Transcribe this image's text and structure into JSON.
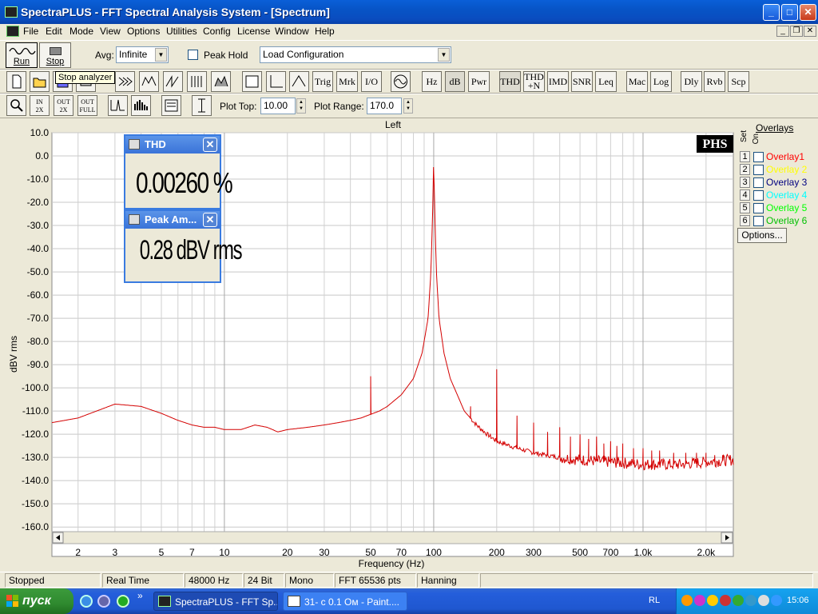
{
  "window": {
    "title": "SpectraPLUS - FFT Spectral Analysis System - [Spectrum]",
    "min_glyph": "_",
    "max_glyph": "□",
    "close_glyph": "✕",
    "mdi_min_glyph": "_",
    "mdi_restore_glyph": "❐",
    "mdi_close_glyph": "✕"
  },
  "menu": [
    "File",
    "Edit",
    "Mode",
    "View",
    "Options",
    "Utilities",
    "Config",
    "License",
    "Window",
    "Help"
  ],
  "toolbar1": {
    "run_label": "Run",
    "stop_label": "Stop",
    "avg_label": "Avg:",
    "avg_value": "Infinite",
    "peak_hold_label": "Peak Hold",
    "config_value": "Load Configuration",
    "tooltip": "Stop analyzer"
  },
  "toolbar2": {
    "buttons": [
      "Trig",
      "Mrk",
      "I/O",
      "Hz",
      "dB",
      "Pwr",
      "THD",
      "IMD",
      "SNR",
      "Leq",
      "Mac",
      "Log",
      "Dly",
      "Rvb",
      "Scp"
    ],
    "thdn_line1": "THD",
    "thdn_line2": "+N"
  },
  "toolbar3": {
    "plot_top_label": "Plot Top:",
    "plot_top_value": "10.00",
    "plot_range_label": "Plot Range:",
    "plot_range_value": "170.0",
    "zoom_in_label": "IN",
    "zoom_in_factor": "2X",
    "zoom_out_label": "OUT",
    "zoom_out_factor": "2X",
    "zoom_full_label": "OUT",
    "zoom_full_word": "FULL"
  },
  "chart_data": {
    "type": "line",
    "title": "Left",
    "xlabel": "Frequency (Hz)",
    "ylabel": "dBV rms",
    "x_scale": "log",
    "xlim": [
      1.5,
      2700
    ],
    "ylim": [
      -162,
      10
    ],
    "x_ticks": [
      2,
      3,
      5,
      7,
      10,
      20,
      30,
      50,
      70,
      100,
      200,
      300,
      500,
      700,
      1000,
      2000
    ],
    "x_tick_labels": [
      "2",
      "3",
      "5",
      "7",
      "10",
      "20",
      "30",
      "50",
      "70",
      "100",
      "200",
      "300",
      "500",
      "700",
      "1.0k",
      "2.0k"
    ],
    "y_ticks": [
      10,
      0,
      -10,
      -20,
      -30,
      -40,
      -50,
      -60,
      -70,
      -80,
      -90,
      -100,
      -110,
      -120,
      -130,
      -140,
      -150,
      -160
    ],
    "y_tick_labels": [
      "10.0",
      "0.0",
      "-10.0",
      "-20.0",
      "-30.0",
      "-40.0",
      "-50.0",
      "-60.0",
      "-70.0",
      "-80.0",
      "-90.0",
      "-100.0",
      "-110.0",
      "-120.0",
      "-130.0",
      "-140.0",
      "-150.0",
      "-160.0"
    ],
    "grid": true,
    "line_color": "#d40000",
    "baseline": [
      [
        1.5,
        -115
      ],
      [
        2,
        -113
      ],
      [
        3,
        -107
      ],
      [
        4,
        -108
      ],
      [
        5,
        -111
      ],
      [
        6,
        -114
      ],
      [
        7,
        -116
      ],
      [
        8,
        -117
      ],
      [
        9,
        -117
      ],
      [
        10,
        -118
      ],
      [
        12,
        -118
      ],
      [
        14,
        -116
      ],
      [
        16,
        -117
      ],
      [
        18,
        -119
      ],
      [
        20,
        -118
      ],
      [
        25,
        -117
      ],
      [
        30,
        -116
      ],
      [
        35,
        -115
      ],
      [
        40,
        -114
      ],
      [
        45,
        -113
      ],
      [
        48,
        -112
      ],
      [
        55,
        -110
      ],
      [
        60,
        -108
      ],
      [
        70,
        -103
      ],
      [
        80,
        -96
      ],
      [
        88,
        -85
      ],
      [
        94,
        -70
      ],
      [
        97,
        -50
      ],
      [
        99,
        -22
      ],
      [
        100,
        0
      ],
      [
        101,
        -22
      ],
      [
        103,
        -50
      ],
      [
        106,
        -70
      ],
      [
        112,
        -85
      ],
      [
        120,
        -96
      ],
      [
        140,
        -110
      ],
      [
        160,
        -116
      ],
      [
        180,
        -120
      ],
      [
        200,
        -123
      ],
      [
        250,
        -126
      ],
      [
        300,
        -128
      ],
      [
        400,
        -130
      ],
      [
        500,
        -131
      ],
      [
        700,
        -132
      ],
      [
        1000,
        -133
      ],
      [
        1500,
        -133
      ],
      [
        2000,
        -132
      ],
      [
        2700,
        -131
      ]
    ],
    "harmonic_spikes": [
      [
        50,
        -95
      ],
      [
        150,
        -108
      ],
      [
        200,
        -92
      ],
      [
        250,
        -112
      ],
      [
        300,
        -115
      ],
      [
        350,
        -119
      ],
      [
        400,
        -117
      ],
      [
        450,
        -121
      ],
      [
        500,
        -120
      ],
      [
        550,
        -122
      ],
      [
        600,
        -121
      ],
      [
        650,
        -124
      ],
      [
        700,
        -123
      ],
      [
        750,
        -125
      ],
      [
        800,
        -124
      ],
      [
        900,
        -126
      ],
      [
        1000,
        -126
      ],
      [
        1100,
        -127
      ],
      [
        1200,
        -127
      ],
      [
        1400,
        -128
      ],
      [
        1600,
        -128
      ],
      [
        1800,
        -128
      ],
      [
        2000,
        -128
      ],
      [
        2200,
        -129
      ],
      [
        2400,
        -129
      ],
      [
        2600,
        -129
      ]
    ],
    "noise_floor_low": -134,
    "noise_floor_high": -126
  },
  "overlays": {
    "title": "Overlays",
    "set_label": "Set",
    "on_label": "On",
    "items": [
      {
        "num": "1",
        "label": "Overlay1",
        "color": "#ff0000"
      },
      {
        "num": "2",
        "label": "Overlay 2",
        "color": "#ffff00"
      },
      {
        "num": "3",
        "label": "Overlay 3",
        "color": "#000080"
      },
      {
        "num": "4",
        "label": "Overlay 4",
        "color": "#00ffff"
      },
      {
        "num": "5",
        "label": "Overlay 5",
        "color": "#00ff00"
      },
      {
        "num": "6",
        "label": "Overlay 6",
        "color": "#00c000"
      }
    ],
    "options_label": "Options..."
  },
  "meters": {
    "thd_title": "THD",
    "thd_value": "0.00260 %",
    "peak_title": "Peak Am...",
    "peak_value": "0.28 dBV rms",
    "close_glyph": "✕"
  },
  "logo": "PHS",
  "status": {
    "state": "Stopped",
    "mode": "Real Time",
    "rate": "48000 Hz",
    "bits": "24 Bit",
    "channels": "Mono",
    "fft": "FFT 65536 pts",
    "window": "Hanning"
  },
  "taskbar": {
    "start_label": "пуск",
    "chevron": "»",
    "tasks": [
      "SpectraPLUS - FFT Sp...",
      "31- c 0.1 Ом - Paint...."
    ],
    "lang": "RL",
    "clock": "15:06"
  }
}
